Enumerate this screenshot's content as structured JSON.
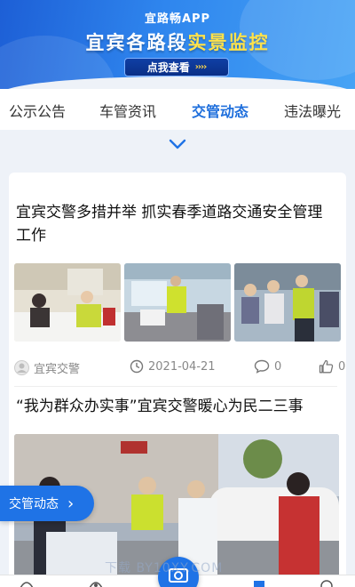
{
  "banner": {
    "app_title": "宜路畅APP",
    "headline_pre": "宜宾各路段",
    "headline_highlight": "实景监控",
    "cta_label": "点我查看",
    "cta_arrows": "››››"
  },
  "tabs": [
    {
      "label": "公示公告",
      "active": false
    },
    {
      "label": "车管资讯",
      "active": false
    },
    {
      "label": "交管动态",
      "active": true
    },
    {
      "label": "违法曝光",
      "active": false
    }
  ],
  "articles": [
    {
      "title": "宜宾交警多措并举 抓实春季道路交通安全管理工作",
      "source": "宜宾交警",
      "date": "2021-04-21",
      "comments": "0",
      "likes": "0"
    },
    {
      "title": "“我为群众办实事”宜宾交警暖心为民二三事"
    }
  ],
  "floating_button": {
    "label": "交管动态",
    "arrow": "›"
  },
  "watermark": "下载  BY10XY.COM",
  "colors": {
    "accent": "#1f73e6",
    "highlight": "#ffe24a"
  }
}
